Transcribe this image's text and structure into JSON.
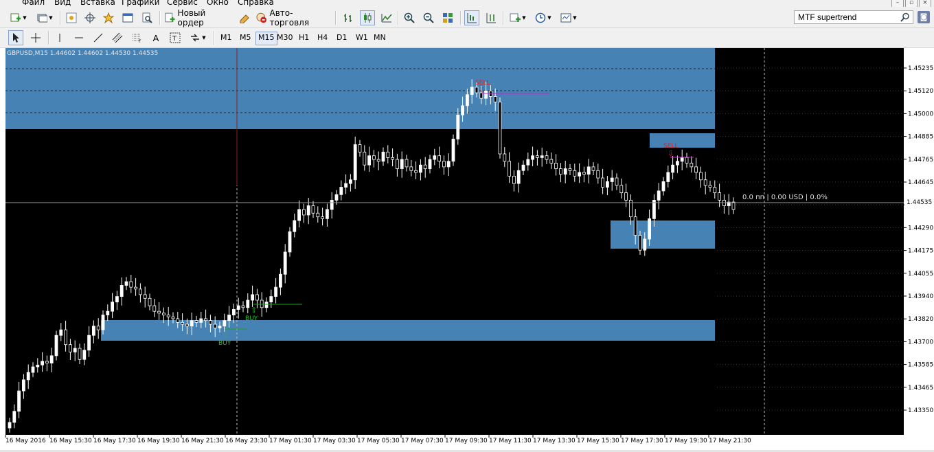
{
  "menu": [
    "Файл",
    "Вид",
    "Вставка",
    "Графики",
    "Сервис",
    "Окно",
    "Справка"
  ],
  "toolbar": {
    "new_order": "Новый ордер",
    "auto_trading": "Авто-торговля",
    "search_value": "MTF supertrend"
  },
  "timeframes": [
    "M1",
    "M5",
    "M15",
    "M30",
    "H1",
    "H4",
    "D1",
    "W1",
    "MN"
  ],
  "active_timeframe": "M15",
  "chart": {
    "title": "GBPUSD,M15  1.44602 1.44602 1.44530 1.44535",
    "info": "0.0 пп | 0.00 USD | 0.0%",
    "current_price": "1.44535",
    "price_labels": [
      "1.45235",
      "1.45120",
      "1.45000",
      "1.44885",
      "1.44765",
      "1.44645",
      "1.44410",
      "1.44290",
      "1.44175",
      "1.44055",
      "1.43940",
      "1.43820",
      "1.43700",
      "1.43585",
      "1.43465",
      "1.43350"
    ],
    "time_labels": [
      "16 May 2016",
      "16 May 15:30",
      "16 May 17:30",
      "16 May 19:30",
      "16 May 21:30",
      "16 May 23:30",
      "17 May 01:30",
      "17 May 03:30",
      "17 May 05:30",
      "17 May 07:30",
      "17 May 09:30",
      "17 May 11:30",
      "17 May 13:30",
      "17 May 15:30",
      "17 May 17:30",
      "17 May 19:30",
      "17 May 21:30"
    ],
    "signals": [
      {
        "text": "BUY",
        "color": "#22c022"
      },
      {
        "text": "BUY",
        "color": "#22c022"
      },
      {
        "text": "SELL",
        "color": "#e02020"
      },
      {
        "text": "SELL",
        "color": "#e02020"
      }
    ],
    "zone_color": "#4682b4",
    "background": "#000000",
    "candle_color": "#ffffff"
  },
  "chart_data": {
    "type": "candlestick",
    "symbol": "GBPUSD",
    "timeframe": "M15",
    "ylim": [
      1.4335,
      1.4529
    ],
    "close": [
      1.4338,
      1.4344,
      1.4355,
      1.4361,
      1.4365,
      1.4368,
      1.4369,
      1.4371,
      1.437,
      1.4374,
      1.4385,
      1.4388,
      1.438,
      1.4376,
      1.4378,
      1.4372,
      1.4377,
      1.4385,
      1.439,
      1.4388,
      1.4396,
      1.4398,
      1.4403,
      1.4406,
      1.4412,
      1.4414,
      1.4411,
      1.441,
      1.4407,
      1.4405,
      1.4401,
      1.4398,
      1.4397,
      1.4396,
      1.4395,
      1.4394,
      1.4392,
      1.4391,
      1.439,
      1.4393,
      1.4392,
      1.4394,
      1.4393,
      1.4391,
      1.4389,
      1.439,
      1.4393,
      1.4396,
      1.4399,
      1.4401,
      1.44,
      1.4404,
      1.4407,
      1.4404,
      1.44,
      1.4403,
      1.4406,
      1.4411,
      1.4418,
      1.443,
      1.4441,
      1.4447,
      1.4453,
      1.445,
      1.4455,
      1.4451,
      1.4449,
      1.4448,
      1.4453,
      1.4458,
      1.4461,
      1.4465,
      1.4467,
      1.4469,
      1.4488,
      1.4484,
      1.4477,
      1.4482,
      1.448,
      1.4479,
      1.4484,
      1.4481,
      1.448,
      1.4475,
      1.448,
      1.4476,
      1.4474,
      1.4473,
      1.4477,
      1.4475,
      1.448,
      1.4482,
      1.4479,
      1.4476,
      1.4479,
      1.4491,
      1.4504,
      1.4509,
      1.4515,
      1.4519,
      1.4516,
      1.4513,
      1.4517,
      1.4514,
      1.4511,
      1.4483,
      1.4479,
      1.4471,
      1.4467,
      1.4474,
      1.4477,
      1.448,
      1.4482,
      1.4481,
      1.4482,
      1.448,
      1.4478,
      1.4475,
      1.4472,
      1.4475,
      1.4474,
      1.4471,
      1.4473,
      1.4472,
      1.4476,
      1.4474,
      1.447,
      1.4465,
      1.4468,
      1.447,
      1.4466,
      1.4462,
      1.4458,
      1.4449,
      1.4439,
      1.4431,
      1.4437,
      1.4448,
      1.4458,
      1.4463,
      1.4468,
      1.4473,
      1.4477,
      1.4479,
      1.4481,
      1.4478,
      1.4476,
      1.4473,
      1.4469,
      1.4466,
      1.4465,
      1.4462,
      1.4458,
      1.4455,
      1.4457,
      1.4453
    ]
  }
}
